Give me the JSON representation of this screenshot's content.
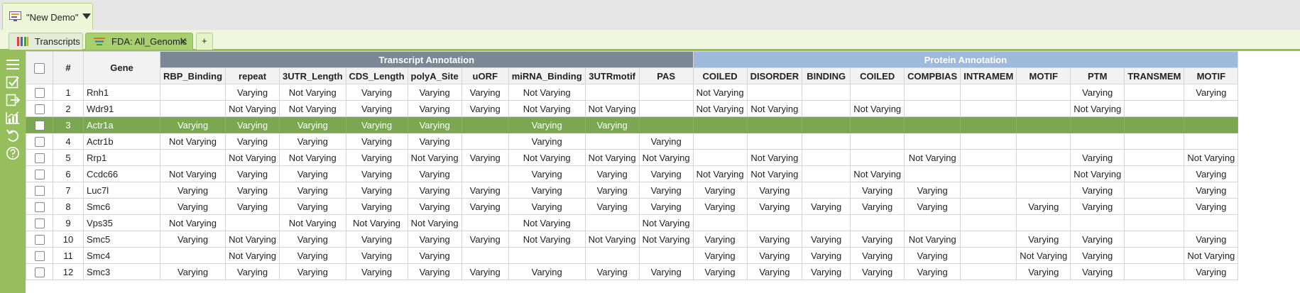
{
  "window": {
    "doc_tab_title": "\"New Demo\""
  },
  "tabs": [
    {
      "label": "Transcripts"
    },
    {
      "label": "FDA: All_Genomic",
      "close": "✕"
    },
    {
      "label": "+"
    }
  ],
  "grid": {
    "index_header": "#",
    "gene_header": "Gene",
    "groups": [
      {
        "label": "Transcript Annotation",
        "span": 9
      },
      {
        "label": "Protein Annotation",
        "span": 10
      }
    ],
    "columns": [
      "RBP_Binding",
      "repeat",
      "3UTR_Length",
      "CDS_Length",
      "polyA_Site",
      "uORF",
      "miRNA_Binding",
      "3UTRmotif",
      "PAS",
      "COILED",
      "DISORDER",
      "BINDING",
      "COILED",
      "COMPBIAS",
      "INTRAMEM",
      "MOTIF",
      "PTM",
      "TRANSMEM",
      "MOTIF"
    ],
    "selected_row": 3,
    "rows": [
      {
        "n": "1",
        "gene": "Rnh1",
        "cells": [
          "",
          "Varying",
          "Not Varying",
          "Varying",
          "Varying",
          "Varying",
          "Not Varying",
          "",
          "",
          "Not Varying",
          "",
          "",
          "",
          "",
          "",
          "",
          "Varying",
          "",
          "Varying"
        ]
      },
      {
        "n": "2",
        "gene": "Wdr91",
        "cells": [
          "",
          "Not Varying",
          "Not Varying",
          "Varying",
          "Varying",
          "Varying",
          "Not Varying",
          "Not Varying",
          "",
          "Not Varying",
          "Not Varying",
          "",
          "Not Varying",
          "",
          "",
          "",
          "Not Varying",
          "",
          ""
        ]
      },
      {
        "n": "3",
        "gene": "Actr1a",
        "cells": [
          "Varying",
          "Varying",
          "Varying",
          "Varying",
          "Varying",
          "",
          "Varying",
          "Varying",
          "",
          "",
          "",
          "",
          "",
          "",
          "",
          "",
          "",
          "",
          ""
        ]
      },
      {
        "n": "4",
        "gene": "Actr1b",
        "cells": [
          "Not Varying",
          "Varying",
          "Varying",
          "Varying",
          "Varying",
          "",
          "Varying",
          "",
          "Varying",
          "",
          "",
          "",
          "",
          "",
          "",
          "",
          "",
          "",
          ""
        ]
      },
      {
        "n": "5",
        "gene": "Rrp1",
        "cells": [
          "",
          "Not Varying",
          "Not Varying",
          "Varying",
          "Not Varying",
          "Varying",
          "Not Varying",
          "Not Varying",
          "Not Varying",
          "",
          "Not Varying",
          "",
          "",
          "Not Varying",
          "",
          "",
          "Varying",
          "",
          "Not Varying"
        ]
      },
      {
        "n": "6",
        "gene": "Ccdc66",
        "cells": [
          "Not Varying",
          "Varying",
          "Varying",
          "Varying",
          "Varying",
          "",
          "Varying",
          "Varying",
          "Varying",
          "Not Varying",
          "Not Varying",
          "",
          "Not Varying",
          "",
          "",
          "",
          "Not Varying",
          "",
          "Varying"
        ]
      },
      {
        "n": "7",
        "gene": "Luc7l",
        "cells": [
          "Varying",
          "Varying",
          "Varying",
          "Varying",
          "Varying",
          "Varying",
          "Varying",
          "Varying",
          "Varying",
          "Varying",
          "Varying",
          "",
          "Varying",
          "Varying",
          "",
          "",
          "Varying",
          "",
          "Varying"
        ]
      },
      {
        "n": "8",
        "gene": "Smc6",
        "cells": [
          "Varying",
          "Varying",
          "Varying",
          "Varying",
          "Varying",
          "Varying",
          "Varying",
          "Varying",
          "Varying",
          "Varying",
          "Varying",
          "Varying",
          "Varying",
          "Varying",
          "",
          "Varying",
          "Varying",
          "",
          "Varying"
        ]
      },
      {
        "n": "9",
        "gene": "Vps35",
        "cells": [
          "Not Varying",
          "",
          "Not Varying",
          "Not Varying",
          "Not Varying",
          "",
          "Not Varying",
          "",
          "Not Varying",
          "",
          "",
          "",
          "",
          "",
          "",
          "",
          "",
          "",
          ""
        ]
      },
      {
        "n": "10",
        "gene": "Smc5",
        "cells": [
          "Varying",
          "Not Varying",
          "Varying",
          "Varying",
          "Varying",
          "Varying",
          "Not Varying",
          "Not Varying",
          "Not Varying",
          "Varying",
          "Varying",
          "Varying",
          "Varying",
          "Not Varying",
          "",
          "Varying",
          "Varying",
          "",
          "Varying"
        ]
      },
      {
        "n": "11",
        "gene": "Smc4",
        "cells": [
          "",
          "Not Varying",
          "Varying",
          "Varying",
          "Varying",
          "",
          "",
          "",
          "",
          "Varying",
          "Varying",
          "Varying",
          "Varying",
          "Varying",
          "",
          "Not Varying",
          "Varying",
          "",
          "Not Varying"
        ]
      },
      {
        "n": "12",
        "gene": "Smc3",
        "cells": [
          "Varying",
          "Varying",
          "Varying",
          "Varying",
          "Varying",
          "Varying",
          "Varying",
          "Varying",
          "Varying",
          "Varying",
          "Varying",
          "Varying",
          "Varying",
          "Varying",
          "",
          "Varying",
          "Varying",
          "",
          "Varying"
        ]
      }
    ]
  },
  "colors": {
    "toolbar_green": "#97be5d",
    "selected_row": "#7aa74f",
    "transcript_group": "#7a8895",
    "protein_group": "#9db9dc"
  },
  "icons": [
    "menu-icon",
    "checklist-icon",
    "export-icon",
    "chart-icon",
    "undo-icon",
    "help-icon",
    "document-icon",
    "bar-chart-icon",
    "filter-lines-icon"
  ]
}
